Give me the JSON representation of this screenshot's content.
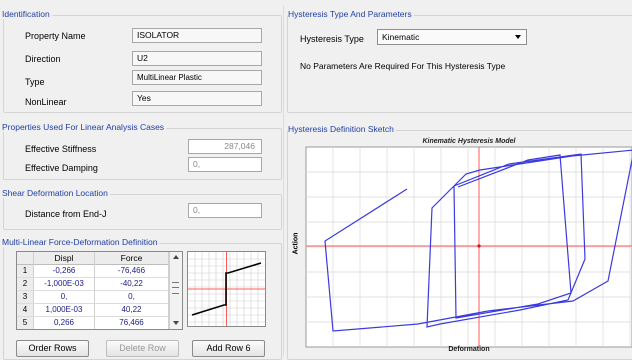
{
  "identification": {
    "title": "Identification",
    "property_name_label": "Property Name",
    "property_name_value": "ISOLATOR",
    "direction_label": "Direction",
    "direction_value": "U2",
    "type_label": "Type",
    "type_value": "MultiLinear Plastic",
    "nonlinear_label": "NonLinear",
    "nonlinear_value": "Yes"
  },
  "linear_props": {
    "title": "Properties Used For Linear Analysis Cases",
    "stiffness_label": "Effective Stiffness",
    "stiffness_value": "287,046",
    "damping_label": "Effective Damping",
    "damping_value": "0,"
  },
  "shear_location": {
    "title": "Shear Deformation Location",
    "distance_label": "Distance from End-J",
    "distance_value": "0,"
  },
  "multilinear": {
    "title": "Multi-Linear Force-Deformation Definition",
    "col_displ": "Displ",
    "col_force": "Force",
    "rows": [
      {
        "n": "1",
        "displ": "-0,266",
        "force": "-76,466"
      },
      {
        "n": "2",
        "displ": "-1,000E-03",
        "force": "-40,22"
      },
      {
        "n": "3",
        "displ": "0,",
        "force": "0,"
      },
      {
        "n": "4",
        "displ": "1,000E-03",
        "force": "40,22"
      },
      {
        "n": "5",
        "displ": "0,266",
        "force": "76,466"
      }
    ],
    "order_rows_label": "Order Rows",
    "delete_row_label": "Delete Row",
    "add_row_label": "Add Row 6"
  },
  "hysteresis_params": {
    "title": "Hysteresis Type And Parameters",
    "type_label": "Hysteresis Type",
    "type_value": "Kinematic",
    "note": "No Parameters Are Required For This Hysteresis Type"
  },
  "sketch": {
    "title": "Hysteresis Definition Sketch",
    "plot_title": "Kinematic Hysteresis Model",
    "ylabel": "Action",
    "xlabel": "Deformation",
    "colors": {
      "curve": "#3a3ae0",
      "axis": "#ff5a5a",
      "grid": "#d9d9d9"
    }
  }
}
